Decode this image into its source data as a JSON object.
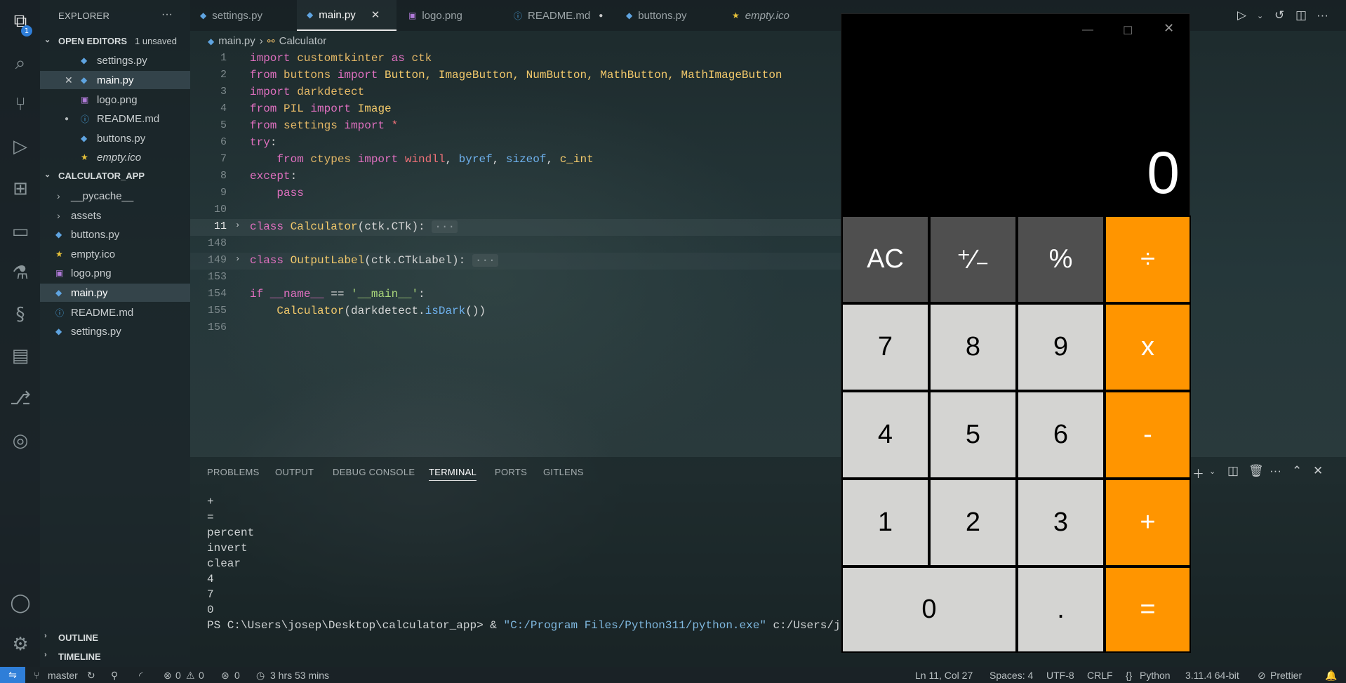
{
  "explorer": {
    "title": "EXPLORER",
    "more": "···",
    "open_editors": {
      "label": "OPEN EDITORS",
      "unsaved": "1 unsaved",
      "items": [
        "settings.py",
        "main.py",
        "logo.png",
        "README.md",
        "buttons.py",
        "empty.ico"
      ]
    },
    "project": {
      "label": "CALCULATOR_APP",
      "items": [
        "__pycache__",
        "assets",
        "buttons.py",
        "empty.ico",
        "logo.png",
        "main.py",
        "README.md",
        "settings.py"
      ]
    },
    "outline": "OUTLINE",
    "timeline": "TIMELINE"
  },
  "tabs": [
    "settings.py",
    "main.py",
    "logo.png",
    "README.md",
    "buttons.py",
    "empty.ico"
  ],
  "breadcrumb": {
    "file": "main.py",
    "symbol": "Calculator"
  },
  "editor": {
    "line_numbers": [
      "1",
      "2",
      "3",
      "4",
      "5",
      "6",
      "7",
      "8",
      "9",
      "10",
      "11",
      "148",
      "149",
      "153",
      "154",
      "155",
      "156"
    ],
    "lines": {
      "l1": {
        "a": "import",
        "b": " customtkinter ",
        "c": "as",
        "d": " ctk"
      },
      "l2": {
        "a": "from",
        "b": " buttons ",
        "c": "import",
        "d": " Button, ImageButton, NumButton, MathButton, MathImageButton"
      },
      "l3": {
        "a": "import",
        "b": " darkdetect"
      },
      "l4": {
        "a": "from",
        "b": " PIL ",
        "c": "import",
        "d": " Image"
      },
      "l5": {
        "a": "from",
        "b": " settings ",
        "c": "import",
        "d": " *"
      },
      "l6": {
        "a": "try",
        "b": ":"
      },
      "l7": {
        "a": "from",
        "b": " ctypes ",
        "c": "import",
        "d": " windll",
        "e": ", ",
        "f": "byref",
        "g": ", ",
        "h": "sizeof",
        "i": ", ",
        "j": "c_int"
      },
      "l8": {
        "a": "except",
        "b": ":"
      },
      "l9": {
        "a": "pass"
      },
      "l11": {
        "a": "class",
        "b": " Calculator",
        "c": "(ctk.CTk):",
        "d": "···"
      },
      "l149": {
        "a": "class",
        "b": " OutputLabel",
        "c": "(ctk.CTkLabel):",
        "d": "···"
      },
      "l154": {
        "a": "if",
        "b": " __name__",
        "c": " == ",
        "d": "'__main__'",
        "e": ":"
      },
      "l155": {
        "a": "Calculator",
        "b": "(darkdetect.",
        "c": "isDark",
        "d": "())"
      }
    }
  },
  "panel": {
    "tabs": [
      "PROBLEMS",
      "OUTPUT",
      "DEBUG CONSOLE",
      "TERMINAL",
      "PORTS",
      "GITLENS"
    ],
    "terminal_lines": [
      "+",
      "=",
      "percent",
      "invert",
      "clear",
      "4",
      "7",
      "0"
    ],
    "prompt": "PS C:\\Users\\josep\\Desktop\\calculator_app> & ",
    "prompt_path": "\"C:/Program Files/Python311/python.exe\"",
    "prompt_tail": " c:/Users/josep/D"
  },
  "status": {
    "branch": "master",
    "errors": "0",
    "warnings": "0",
    "ports": "0",
    "time": "3 hrs 53 mins",
    "position": "Ln 11, Col 27",
    "spaces": "Spaces: 4",
    "encoding": "UTF-8",
    "eol": "CRLF",
    "language": "Python",
    "interpreter": "3.11.4 64-bit",
    "formatter": "Prettier"
  },
  "calculator": {
    "display": "0",
    "keys": [
      {
        "label": "AC",
        "kind": "fn"
      },
      {
        "label": "⁺∕₋",
        "kind": "fn"
      },
      {
        "label": "%",
        "kind": "fn"
      },
      {
        "label": "÷",
        "kind": "op"
      },
      {
        "label": "7",
        "kind": "num"
      },
      {
        "label": "8",
        "kind": "num"
      },
      {
        "label": "9",
        "kind": "num"
      },
      {
        "label": "x",
        "kind": "op"
      },
      {
        "label": "4",
        "kind": "num"
      },
      {
        "label": "5",
        "kind": "num"
      },
      {
        "label": "6",
        "kind": "num"
      },
      {
        "label": "-",
        "kind": "op"
      },
      {
        "label": "1",
        "kind": "num"
      },
      {
        "label": "2",
        "kind": "num"
      },
      {
        "label": "3",
        "kind": "num"
      },
      {
        "label": "+",
        "kind": "op"
      },
      {
        "label": "0",
        "kind": "num"
      },
      {
        "label": ".",
        "kind": "num"
      },
      {
        "label": "=",
        "kind": "op"
      }
    ],
    "colors": {
      "function": "#4f4f4f",
      "number": "#d4d4d2",
      "operator": "#ff9500",
      "display_bg": "#000000"
    }
  },
  "icons": {
    "activity": [
      "files-icon",
      "search-icon",
      "source-control-icon",
      "run-debug-icon",
      "extensions-icon",
      "remote-explorer-icon",
      "testing-icon",
      "python-icon",
      "folder-icon",
      "gitlens-icon",
      "gitlens-inspect-icon",
      "account-icon",
      "settings-gear-icon"
    ],
    "activity_badge": "1"
  }
}
